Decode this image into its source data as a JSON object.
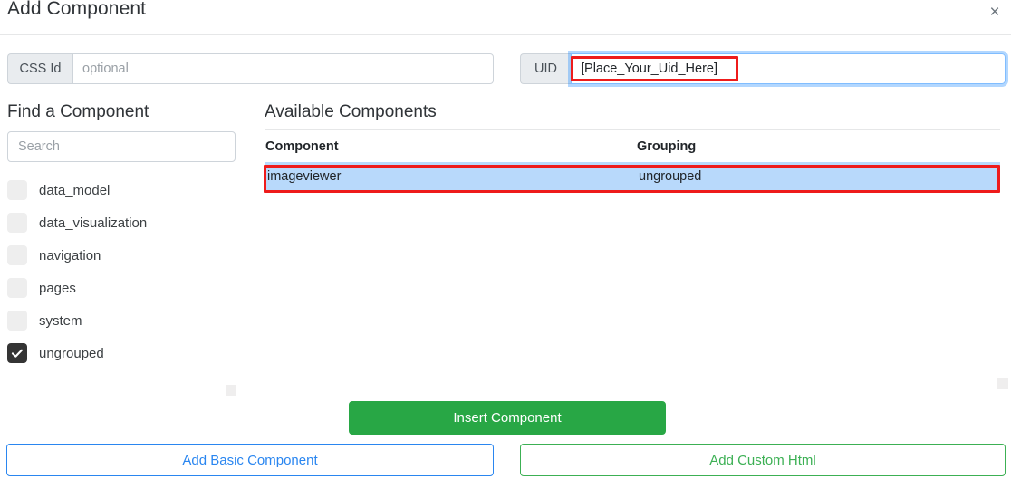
{
  "modal": {
    "title": "Add Component",
    "close_icon": "close-icon",
    "close_label": "×"
  },
  "fields": {
    "css_id": {
      "label": "CSS Id",
      "placeholder": "optional",
      "value": ""
    },
    "uid": {
      "label": "UID",
      "placeholder": "",
      "value": "[Place_Your_Uid_Here]"
    }
  },
  "find_panel": {
    "heading": "Find a Component",
    "search": {
      "placeholder": "Search",
      "value": ""
    },
    "groups": [
      {
        "label": "data_model",
        "checked": false
      },
      {
        "label": "data_visualization",
        "checked": false
      },
      {
        "label": "navigation",
        "checked": false
      },
      {
        "label": "pages",
        "checked": false
      },
      {
        "label": "system",
        "checked": false
      },
      {
        "label": "ungrouped",
        "checked": true
      }
    ]
  },
  "available_panel": {
    "heading": "Available Components",
    "columns": [
      "Component",
      "Grouping"
    ],
    "rows": [
      {
        "component": "imageviewer",
        "grouping": "ungrouped",
        "selected": true
      }
    ]
  },
  "buttons": {
    "insert": "Insert Component",
    "add_basic": "Add Basic Component",
    "add_custom": "Add Custom Html"
  },
  "colors": {
    "insert_green": "#28a745",
    "link_blue": "#2a86f0",
    "outline_green": "#3cb054",
    "row_selected": "#b8d9fb",
    "annotation_red": "#ee1b1b",
    "focus_blue": "#80bdff"
  }
}
